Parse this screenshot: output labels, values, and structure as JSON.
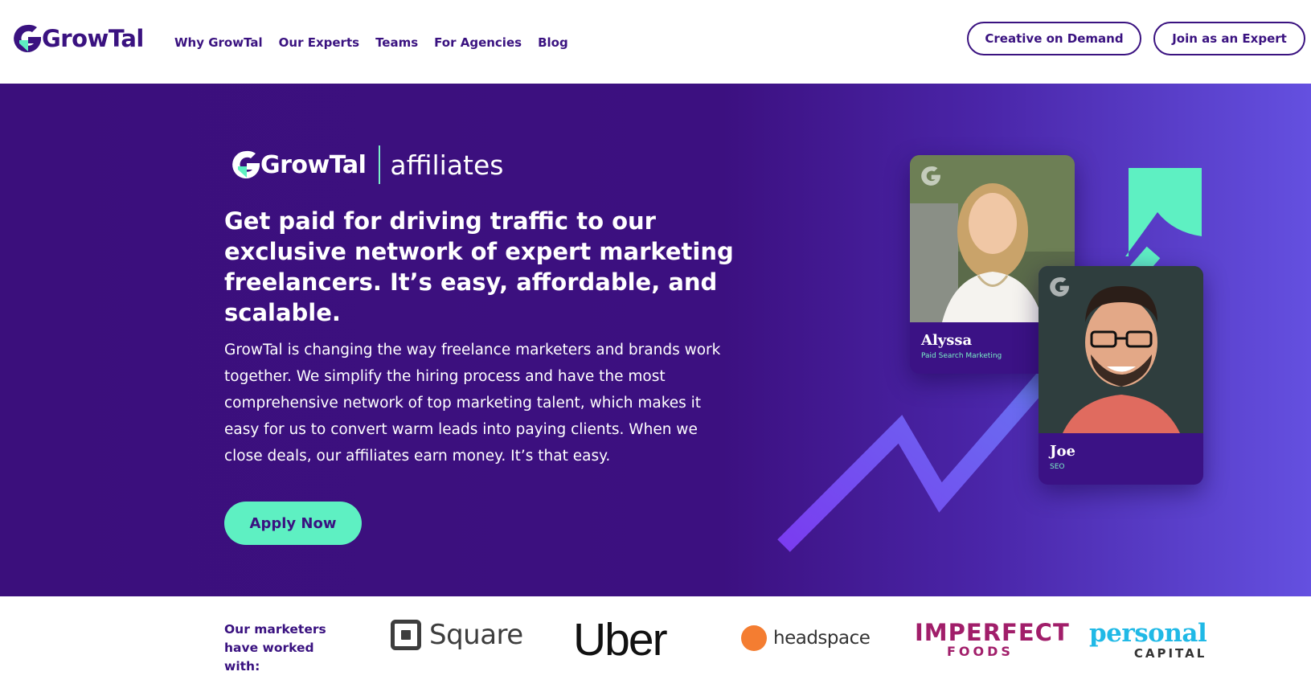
{
  "header": {
    "brand": "GrowTal",
    "nav": [
      "Why GrowTal",
      "Our Experts",
      "Teams",
      "For Agencies",
      "Blog"
    ],
    "cta_creative": "Creative on Demand",
    "cta_join": "Join as an Expert"
  },
  "hero": {
    "brand": "GrowTal",
    "affiliates_word": "affiliates",
    "title": "Get paid for driving traffic to our exclusive network of expert marketing freelancers. It’s easy, affordable, and scalable.",
    "body": "GrowTal is changing the way freelance marketers and brands work together. We simplify the hiring process and have the most comprehensive network of top marketing talent, which makes it easy for us to convert warm leads into paying clients. When we close deals, our affiliates earn money. It’s that easy.",
    "apply_label": "Apply Now",
    "cards": [
      {
        "name": "Alyssa",
        "role": "Paid Search Marketing"
      },
      {
        "name": "Joe",
        "role": "SEO"
      }
    ],
    "accent_color": "#5ef0c2",
    "bg_color": "#3b0f7c"
  },
  "strip": {
    "label": "Our marketers have worked with:",
    "brands": {
      "square": "Square",
      "uber": "Uber",
      "headspace": "headspace",
      "imperfect_top": "IMPERFECT",
      "imperfect_bottom": "FOODS",
      "personal_top": "personal",
      "personal_bottom": "CAPITAL"
    }
  }
}
